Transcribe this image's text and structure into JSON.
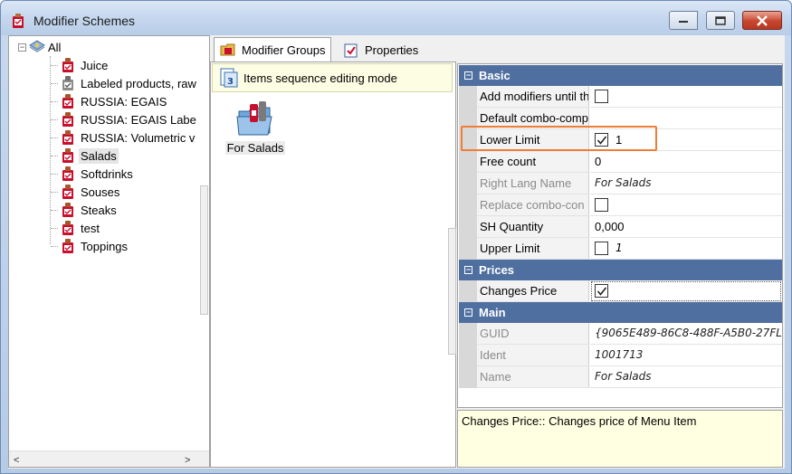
{
  "window": {
    "title": "Modifier Schemes"
  },
  "tree": {
    "root_label": "All",
    "items": [
      {
        "label": "Juice"
      },
      {
        "label": "Labeled products, raw"
      },
      {
        "label": "RUSSIA: EGAIS"
      },
      {
        "label": "RUSSIA: EGAIS Labe"
      },
      {
        "label": "RUSSIA: Volumetric v"
      },
      {
        "label": "Salads",
        "selected": true
      },
      {
        "label": "Softdrinks"
      },
      {
        "label": "Souses"
      },
      {
        "label": "Steaks"
      },
      {
        "label": "test"
      },
      {
        "label": "Toppings"
      }
    ]
  },
  "tabs": [
    {
      "label": "Modifier Groups",
      "active": true
    },
    {
      "label": "Properties",
      "active": false
    }
  ],
  "groups": {
    "sequence_mode_label": "Items sequence editing mode",
    "items": [
      {
        "label": "For Salads"
      }
    ]
  },
  "properties": {
    "categories": [
      {
        "label": "Basic",
        "rows": [
          {
            "name": "Add modifiers until th",
            "type": "checkbox",
            "checked": false,
            "value": ""
          },
          {
            "name": "Default combo-comp",
            "type": "text",
            "value": ""
          },
          {
            "name": "Lower Limit",
            "type": "checkbox",
            "checked": true,
            "value": "1"
          },
          {
            "name": "Free count",
            "type": "text",
            "value": "0"
          },
          {
            "name": "Right Lang Name",
            "type": "italic",
            "readonly": true,
            "value": "For Salads"
          },
          {
            "name": "Replace combo-con",
            "type": "checkbox",
            "readonly": true,
            "checked": false,
            "value": ""
          },
          {
            "name": "SH Quantity",
            "type": "text",
            "value": "0,000"
          },
          {
            "name": "Upper Limit",
            "type": "checkbox",
            "checked": false,
            "value": "1"
          }
        ]
      },
      {
        "label": "Prices",
        "rows": [
          {
            "name": "Changes Price",
            "type": "checkbox",
            "checked": true,
            "value": ""
          }
        ]
      },
      {
        "label": "Main",
        "rows": [
          {
            "name": "GUID",
            "type": "italic",
            "readonly": true,
            "value": "{9065E489-86C8-488F-A5B0-27FL"
          },
          {
            "name": "Ident",
            "type": "italic",
            "readonly": true,
            "value": "1001713"
          },
          {
            "name": "Name",
            "type": "italic",
            "readonly": true,
            "value": "For Salads"
          }
        ]
      }
    ]
  },
  "description": "Changes Price:: Changes price of Menu Item",
  "colors": {
    "category_header": "#4f6fa0",
    "highlight_border": "#ee7d36",
    "description_bg": "#ffffe1"
  }
}
